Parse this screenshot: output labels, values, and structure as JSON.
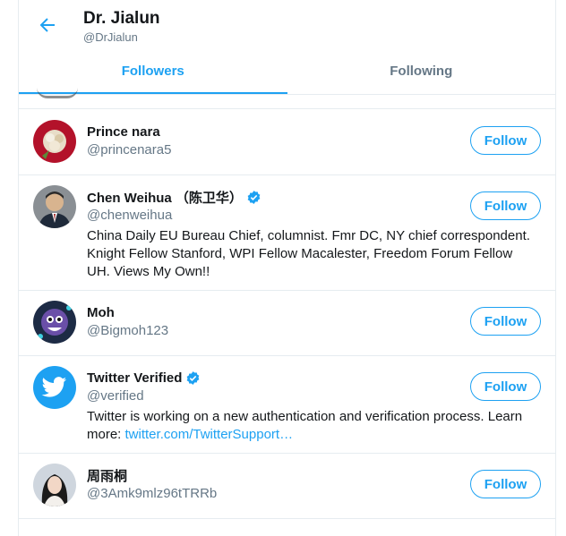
{
  "header": {
    "title": "Dr. Jialun",
    "handle": "@DrJialun",
    "back_icon": "arrow-left-icon"
  },
  "tabs": [
    {
      "label": "Followers",
      "active": true
    },
    {
      "label": "Following",
      "active": false
    }
  ],
  "colors": {
    "accent": "#1da1f2",
    "text": "#14171a",
    "muted": "#657786",
    "border": "#e6ecf0"
  },
  "users": [
    {
      "name": "Prince nara",
      "handle": "@princenara5",
      "verified": false,
      "bio": "",
      "follow_label": "Follow"
    },
    {
      "name": "Chen Weihua （陈卫华）",
      "handle": "@chenweihua",
      "verified": true,
      "bio": "China Daily EU Bureau Chief, columnist. Fmr DC, NY chief correspondent. Knight Fellow Stanford, WPI Fellow Macalester, Freedom Forum Fellow UH. Views My Own!!",
      "follow_label": "Follow"
    },
    {
      "name": "Moh",
      "handle": "@Bigmoh123",
      "verified": false,
      "bio": "",
      "follow_label": "Follow"
    },
    {
      "name": "Twitter Verified",
      "handle": "@verified",
      "verified": true,
      "bio": "Twitter is working on a new authentication and verification process. Learn more: ",
      "bio_link": "twitter.com/TwitterSupport…",
      "follow_label": "Follow"
    },
    {
      "name": "周雨桐",
      "handle": "@3Amk9mlz96tTRRb",
      "verified": false,
      "bio": "",
      "follow_label": "Follow"
    }
  ]
}
